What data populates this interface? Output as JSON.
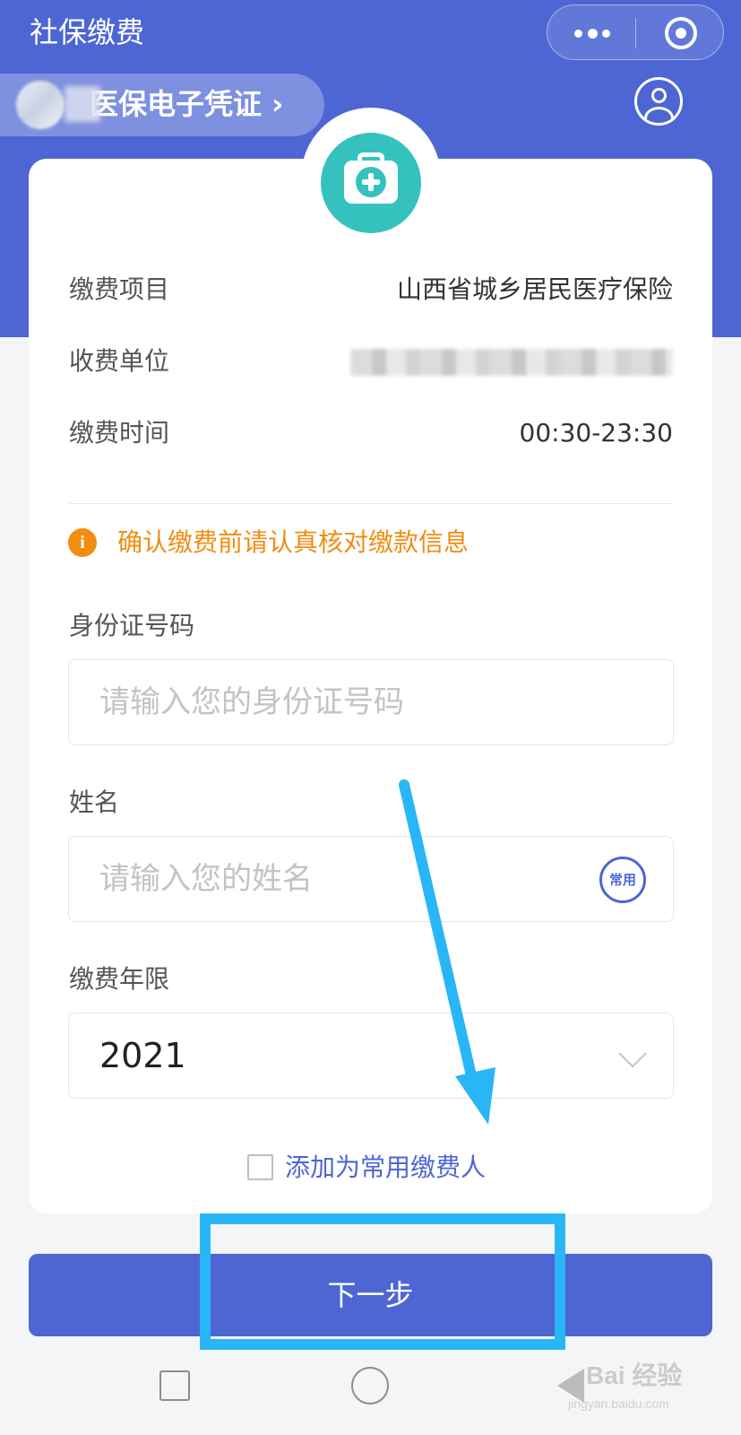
{
  "header": {
    "title": "社保缴费",
    "voucher_label": "医保电子凭证 ›",
    "more_icon": "more-dots-icon",
    "close_icon": "target-circle-icon",
    "user_icon": "user-icon",
    "background_color": "#4d66d4"
  },
  "info": {
    "item_label": "缴费项目",
    "item_value": "山西省城乡居民医疗保险",
    "unit_label": "收费单位",
    "time_label": "缴费时间",
    "time_value": "00:30-23:30"
  },
  "tip": {
    "icon_text": "i",
    "text": "确认缴费前请认真核对缴款信息",
    "color": "#f08d12"
  },
  "form": {
    "id_label": "身份证号码",
    "id_placeholder": "请输入您的身份证号码",
    "name_label": "姓名",
    "name_placeholder": "请输入您的姓名",
    "common_badge": "常用",
    "year_label": "缴费年限",
    "year_value": "2021",
    "add_common_label": "添加为常用缴费人"
  },
  "actions": {
    "next_label": "下一步"
  },
  "annotations": {
    "arrow_color": "#29b6f6"
  },
  "watermark": {
    "main": "Bai 经验",
    "sub": "jingyan.baidu.com"
  }
}
